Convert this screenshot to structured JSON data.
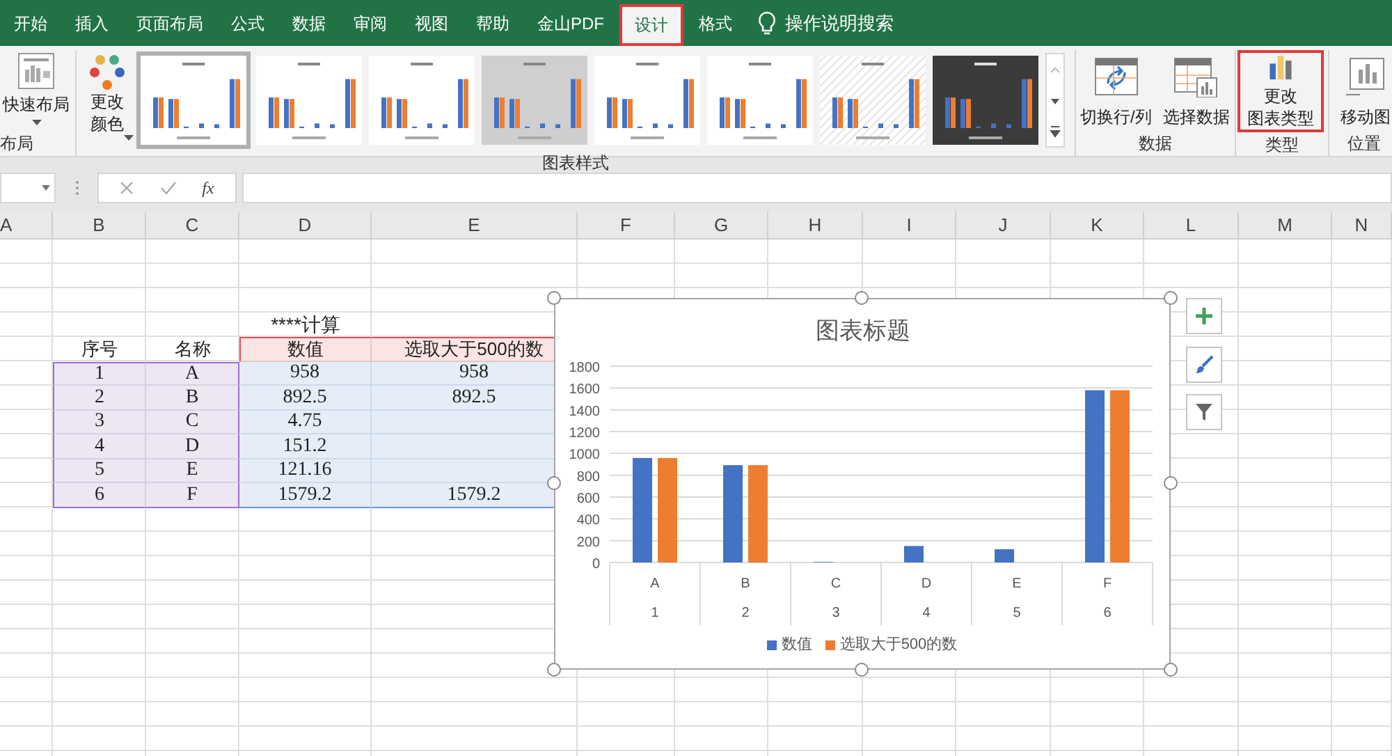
{
  "tabs": [
    {
      "label": "开始",
      "selected": false
    },
    {
      "label": "插入",
      "selected": false
    },
    {
      "label": "页面布局",
      "selected": false
    },
    {
      "label": "公式",
      "selected": false
    },
    {
      "label": "数据",
      "selected": false
    },
    {
      "label": "审阅",
      "selected": false
    },
    {
      "label": "视图",
      "selected": false
    },
    {
      "label": "帮助",
      "selected": false
    },
    {
      "label": "金山PDF",
      "selected": false
    },
    {
      "label": "设计",
      "selected": true
    },
    {
      "label": "格式",
      "selected": false
    }
  ],
  "search": {
    "placeholder": "操作说明搜索"
  },
  "ribbon": {
    "layout_group": {
      "label": "布局",
      "button": "快速布局"
    },
    "styles_group": {
      "label": "图表样式",
      "color_button": [
        "更改",
        "颜色"
      ],
      "thumbnails": [
        {
          "kind": "plain",
          "selected": true
        },
        {
          "kind": "plain",
          "selected": false
        },
        {
          "kind": "plain",
          "selected": false
        },
        {
          "kind": "gray",
          "selected": false
        },
        {
          "kind": "plain",
          "selected": false
        },
        {
          "kind": "plain",
          "selected": false
        },
        {
          "kind": "hatched",
          "selected": false
        },
        {
          "kind": "dark",
          "selected": false
        }
      ]
    },
    "data_group": {
      "label": "数据",
      "buttons": [
        "切换行/列",
        "选择数据"
      ]
    },
    "type_group": {
      "label": "类型",
      "button": [
        "更改",
        "图表类型"
      ],
      "highlighted": true
    },
    "position_group": {
      "label": "位置",
      "button": "移动图"
    }
  },
  "formula_bar": {
    "function_label": "fx"
  },
  "columns": [
    "A",
    "B",
    "C",
    "D",
    "E",
    "F",
    "G",
    "H",
    "I",
    "J",
    "K",
    "L",
    "M",
    "N"
  ],
  "sheet": {
    "title": "****计算",
    "headers": [
      "序号",
      "名称",
      "数值",
      "选取大于500的数"
    ],
    "rows": [
      [
        "1",
        "A",
        "958",
        "958"
      ],
      [
        "2",
        "B",
        "892.5",
        "892.5"
      ],
      [
        "3",
        "C",
        "4.75",
        null
      ],
      [
        "4",
        "D",
        "151.2",
        null
      ],
      [
        "5",
        "E",
        "121.16",
        null
      ],
      [
        "6",
        "F",
        "1579.2",
        "1579.2"
      ]
    ]
  },
  "chart": {
    "category_numbers": [
      "1",
      "2",
      "3",
      "4",
      "5",
      "6"
    ],
    "chart_data": {
      "type": "bar",
      "title": "图表标题",
      "categories": [
        "A",
        "B",
        "C",
        "D",
        "E",
        "F"
      ],
      "series": [
        {
          "name": "数值",
          "color": "#4472c4",
          "values": [
            958,
            892.5,
            4.75,
            151.2,
            121.16,
            1579.2
          ]
        },
        {
          "name": "选取大于500的数",
          "color": "#ed7d31",
          "values": [
            958,
            892.5,
            null,
            null,
            null,
            1579.2
          ]
        }
      ],
      "grid": true,
      "legend": true,
      "ylim": [
        0,
        1800
      ],
      "yticks": [
        0,
        200,
        400,
        600,
        800,
        1000,
        1200,
        1400,
        1600,
        1800
      ]
    }
  }
}
